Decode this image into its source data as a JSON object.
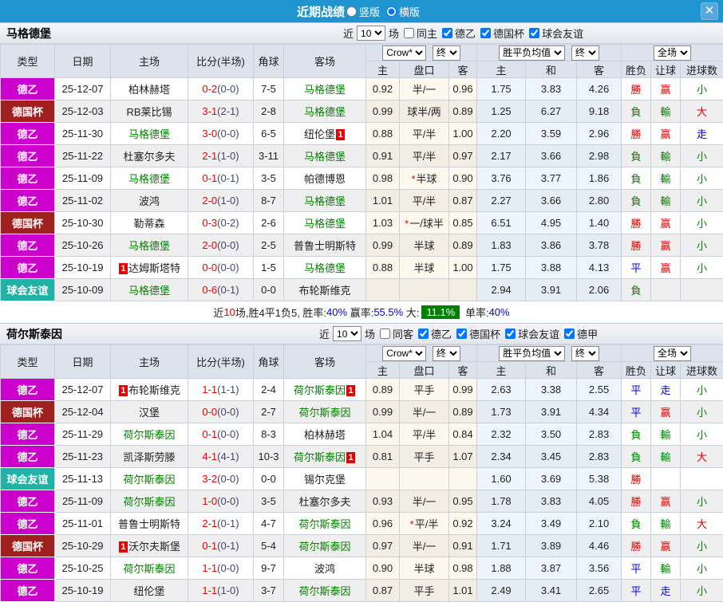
{
  "titlebar": {
    "title": "近期战绩",
    "radio_vertical": {
      "label": "竖版",
      "checked": false
    },
    "radio_horizontal": {
      "label": "横版",
      "checked": true
    },
    "close_glyph": "✕"
  },
  "cols": {
    "type": "类型",
    "date": "日期",
    "home": "主场",
    "score": "比分(半场)",
    "corner": "角球",
    "away": "客场",
    "sub": [
      "主",
      "盘口",
      "客",
      "主",
      "和",
      "客",
      "胜负",
      "让球",
      "进球数"
    ]
  },
  "colors": {
    "accent_blue": "#1f95d0",
    "league2_magenta": "#cc00cc",
    "cup_darkred": "#a02020",
    "friendly_teal": "#21b2a6",
    "win_red": "#e60000",
    "lose_green": "#008000",
    "draw_blue": "#0000ee",
    "highlight_green_bg": "#008000"
  },
  "sections": [
    {
      "team": "马格德堡",
      "filter": {
        "near": "近",
        "count": "10",
        "games": "场",
        "same": {
          "label": "同主",
          "checked": false
        },
        "leagues": [
          {
            "label": "德乙",
            "checked": true
          },
          {
            "label": "德国杯",
            "checked": true
          },
          {
            "label": "球会友谊",
            "checked": true
          }
        ]
      },
      "dd": {
        "odds": "Crow*",
        "fin1": "终",
        "avg": "胜平负均值",
        "fin2": "终",
        "scope": "全场"
      },
      "rows": [
        {
          "tc": "l2",
          "tp": "德乙",
          "d": "25-12-07",
          "h": {
            "n": "柏林赫塔",
            "g": 0
          },
          "s": [
            "0-2",
            "(0-0)"
          ],
          "c": "7-5",
          "a": {
            "n": "马格德堡",
            "g": 1
          },
          "o": [
            "0.92",
            "半/一",
            "0.96"
          ],
          "st": 0,
          "v": [
            "1.75",
            "3.83",
            "4.26"
          ],
          "r": [
            [
              "勝",
              "r"
            ],
            [
              "赢",
              "r"
            ],
            [
              "小",
              "g"
            ]
          ]
        },
        {
          "tc": "cup",
          "tp": "德国杯",
          "d": "25-12-03",
          "h": {
            "n": "RB莱比锡",
            "g": 0
          },
          "s": [
            "3-1",
            "(2-1)"
          ],
          "c": "2-8",
          "a": {
            "n": "马格德堡",
            "g": 1
          },
          "o": [
            "0.99",
            "球半/两",
            "0.89"
          ],
          "st": 0,
          "v": [
            "1.25",
            "6.27",
            "9.18"
          ],
          "r": [
            [
              "負",
              "g"
            ],
            [
              "輸",
              "g"
            ],
            [
              "大",
              "r"
            ]
          ]
        },
        {
          "tc": "l2",
          "tp": "德乙",
          "d": "25-11-30",
          "h": {
            "n": "马格德堡",
            "g": 1
          },
          "s": [
            "3-0",
            "(0-0)"
          ],
          "c": "6-5",
          "a": {
            "n": "纽伦堡",
            "g": 0,
            "b": "1",
            "bp": "a"
          },
          "o": [
            "0.88",
            "平/半",
            "1.00"
          ],
          "st": 0,
          "v": [
            "2.20",
            "3.59",
            "2.96"
          ],
          "r": [
            [
              "勝",
              "r"
            ],
            [
              "赢",
              "r"
            ],
            [
              "走",
              "b"
            ]
          ]
        },
        {
          "tc": "l2",
          "tp": "德乙",
          "d": "25-11-22",
          "h": {
            "n": "杜塞尔多夫",
            "g": 0
          },
          "s": [
            "2-1",
            "(1-0)"
          ],
          "c": "3-11",
          "a": {
            "n": "马格德堡",
            "g": 1
          },
          "o": [
            "0.91",
            "平/半",
            "0.97"
          ],
          "st": 0,
          "v": [
            "2.17",
            "3.66",
            "2.98"
          ],
          "r": [
            [
              "負",
              "g"
            ],
            [
              "輸",
              "g"
            ],
            [
              "小",
              "g"
            ]
          ]
        },
        {
          "tc": "l2",
          "tp": "德乙",
          "d": "25-11-09",
          "h": {
            "n": "马格德堡",
            "g": 1
          },
          "s": [
            "0-1",
            "(0-1)"
          ],
          "c": "3-5",
          "a": {
            "n": "帕德博恩",
            "g": 0
          },
          "o": [
            "0.98",
            "半球",
            "0.90"
          ],
          "st": 1,
          "v": [
            "3.76",
            "3.77",
            "1.86"
          ],
          "r": [
            [
              "負",
              "g"
            ],
            [
              "輸",
              "g"
            ],
            [
              "小",
              "g"
            ]
          ]
        },
        {
          "tc": "l2",
          "tp": "德乙",
          "d": "25-11-02",
          "h": {
            "n": "波鸿",
            "g": 0
          },
          "s": [
            "2-0",
            "(1-0)"
          ],
          "c": "8-7",
          "a": {
            "n": "马格德堡",
            "g": 1
          },
          "o": [
            "1.01",
            "平/半",
            "0.87"
          ],
          "st": 0,
          "v": [
            "2.27",
            "3.66",
            "2.80"
          ],
          "r": [
            [
              "負",
              "g"
            ],
            [
              "輸",
              "g"
            ],
            [
              "小",
              "g"
            ]
          ]
        },
        {
          "tc": "cup",
          "tp": "德国杯",
          "d": "25-10-30",
          "h": {
            "n": "勒蒂森",
            "g": 0
          },
          "s": [
            "0-3",
            "(0-2)"
          ],
          "c": "2-6",
          "a": {
            "n": "马格德堡",
            "g": 1
          },
          "o": [
            "1.03",
            "一/球半",
            "0.85"
          ],
          "st": 1,
          "v": [
            "6.51",
            "4.95",
            "1.40"
          ],
          "r": [
            [
              "勝",
              "r"
            ],
            [
              "赢",
              "r"
            ],
            [
              "小",
              "g"
            ]
          ]
        },
        {
          "tc": "l2",
          "tp": "德乙",
          "d": "25-10-26",
          "h": {
            "n": "马格德堡",
            "g": 1
          },
          "s": [
            "2-0",
            "(0-0)"
          ],
          "c": "2-5",
          "a": {
            "n": "普鲁士明斯特",
            "g": 0
          },
          "o": [
            "0.99",
            "半球",
            "0.89"
          ],
          "st": 0,
          "v": [
            "1.83",
            "3.86",
            "3.78"
          ],
          "r": [
            [
              "勝",
              "r"
            ],
            [
              "赢",
              "r"
            ],
            [
              "小",
              "g"
            ]
          ]
        },
        {
          "tc": "l2",
          "tp": "德乙",
          "d": "25-10-19",
          "h": {
            "n": "达姆斯塔特",
            "g": 0,
            "b": "1",
            "bp": "b"
          },
          "s": [
            "0-0",
            "(0-0)"
          ],
          "c": "1-5",
          "a": {
            "n": "马格德堡",
            "g": 1
          },
          "o": [
            "0.88",
            "半球",
            "1.00"
          ],
          "st": 0,
          "v": [
            "1.75",
            "3.88",
            "4.13"
          ],
          "r": [
            [
              "平",
              "b"
            ],
            [
              "赢",
              "r"
            ],
            [
              "小",
              "g"
            ]
          ]
        },
        {
          "tc": "fr",
          "tp": "球会友谊",
          "d": "25-10-09",
          "h": {
            "n": "马格德堡",
            "g": 1
          },
          "s": [
            "0-6",
            "(0-1)"
          ],
          "c": "0-0",
          "a": {
            "n": "布轮斯维克",
            "g": 0
          },
          "o": [
            "",
            "",
            ""
          ],
          "st": 0,
          "v": [
            "2.94",
            "3.91",
            "2.06"
          ],
          "r": [
            [
              "負",
              "g"
            ],
            null,
            null
          ]
        }
      ],
      "summary": {
        "parts": [
          [
            "近",
            "k"
          ],
          [
            "10",
            "r"
          ],
          [
            "场,胜4平1负5, ",
            "k"
          ],
          [
            "胜率:",
            "k"
          ],
          [
            "40%",
            "b"
          ],
          [
            " 赢率:",
            "k"
          ],
          [
            "55.5%",
            "b"
          ],
          [
            " 大:",
            "k"
          ],
          [
            "11.1%",
            "hl"
          ],
          [
            " 单率:",
            "k"
          ],
          [
            "40%",
            "b"
          ]
        ]
      }
    },
    {
      "team": "荷尔斯泰因",
      "filter": {
        "near": "近",
        "count": "10",
        "games": "场",
        "same": {
          "label": "同客",
          "checked": false
        },
        "leagues": [
          {
            "label": "德乙",
            "checked": true
          },
          {
            "label": "德国杯",
            "checked": true
          },
          {
            "label": "球会友谊",
            "checked": true
          },
          {
            "label": "德甲",
            "checked": true
          }
        ]
      },
      "dd": {
        "odds": "Crow*",
        "fin1": "终",
        "avg": "胜平负均值",
        "fin2": "终",
        "scope": "全场"
      },
      "rows": [
        {
          "tc": "l2",
          "tp": "德乙",
          "d": "25-12-07",
          "h": {
            "n": "布轮斯维克",
            "g": 0,
            "b": "1",
            "bp": "b"
          },
          "s": [
            "1-1",
            "(1-1)"
          ],
          "c": "2-4",
          "a": {
            "n": "荷尔斯泰因",
            "g": 1,
            "b": "1",
            "bp": "a"
          },
          "o": [
            "0.89",
            "平手",
            "0.99"
          ],
          "st": 0,
          "v": [
            "2.63",
            "3.38",
            "2.55"
          ],
          "r": [
            [
              "平",
              "b"
            ],
            [
              "走",
              "b"
            ],
            [
              "小",
              "g"
            ]
          ]
        },
        {
          "tc": "cup",
          "tp": "德国杯",
          "d": "25-12-04",
          "h": {
            "n": "汉堡",
            "g": 0
          },
          "s": [
            "0-0",
            "(0-0)"
          ],
          "c": "2-7",
          "a": {
            "n": "荷尔斯泰因",
            "g": 1
          },
          "o": [
            "0.99",
            "半/一",
            "0.89"
          ],
          "st": 0,
          "v": [
            "1.73",
            "3.91",
            "4.34"
          ],
          "r": [
            [
              "平",
              "b"
            ],
            [
              "赢",
              "r"
            ],
            [
              "小",
              "g"
            ]
          ]
        },
        {
          "tc": "l2",
          "tp": "德乙",
          "d": "25-11-29",
          "h": {
            "n": "荷尔斯泰因",
            "g": 1
          },
          "s": [
            "0-1",
            "(0-0)"
          ],
          "c": "8-3",
          "a": {
            "n": "柏林赫塔",
            "g": 0
          },
          "o": [
            "1.04",
            "平/半",
            "0.84"
          ],
          "st": 0,
          "v": [
            "2.32",
            "3.50",
            "2.83"
          ],
          "r": [
            [
              "負",
              "g"
            ],
            [
              "輸",
              "g"
            ],
            [
              "小",
              "g"
            ]
          ]
        },
        {
          "tc": "l2",
          "tp": "德乙",
          "d": "25-11-23",
          "h": {
            "n": "凯泽斯劳滕",
            "g": 0
          },
          "s": [
            "4-1",
            "(4-1)"
          ],
          "c": "10-3",
          "a": {
            "n": "荷尔斯泰因",
            "g": 1,
            "b": "1",
            "bp": "a"
          },
          "o": [
            "0.81",
            "平手",
            "1.07"
          ],
          "st": 0,
          "v": [
            "2.34",
            "3.45",
            "2.83"
          ],
          "r": [
            [
              "負",
              "g"
            ],
            [
              "輸",
              "g"
            ],
            [
              "大",
              "r"
            ]
          ]
        },
        {
          "tc": "fr",
          "tp": "球会友谊",
          "d": "25-11-13",
          "h": {
            "n": "荷尔斯泰因",
            "g": 1
          },
          "s": [
            "3-2",
            "(0-0)"
          ],
          "c": "0-0",
          "a": {
            "n": "锡尔克堡",
            "g": 0
          },
          "o": [
            "",
            "",
            ""
          ],
          "st": 0,
          "v": [
            "1.60",
            "3.69",
            "5.38"
          ],
          "r": [
            [
              "勝",
              "r"
            ],
            null,
            null
          ]
        },
        {
          "tc": "l2",
          "tp": "德乙",
          "d": "25-11-09",
          "h": {
            "n": "荷尔斯泰因",
            "g": 1
          },
          "s": [
            "1-0",
            "(0-0)"
          ],
          "c": "3-5",
          "a": {
            "n": "杜塞尔多夫",
            "g": 0
          },
          "o": [
            "0.93",
            "半/一",
            "0.95"
          ],
          "st": 0,
          "v": [
            "1.78",
            "3.83",
            "4.05"
          ],
          "r": [
            [
              "勝",
              "r"
            ],
            [
              "赢",
              "r"
            ],
            [
              "小",
              "g"
            ]
          ]
        },
        {
          "tc": "l2",
          "tp": "德乙",
          "d": "25-11-01",
          "h": {
            "n": "普鲁士明斯特",
            "g": 0
          },
          "s": [
            "2-1",
            "(0-1)"
          ],
          "c": "4-7",
          "a": {
            "n": "荷尔斯泰因",
            "g": 1
          },
          "o": [
            "0.96",
            "平/半",
            "0.92"
          ],
          "st": 1,
          "v": [
            "3.24",
            "3.49",
            "2.10"
          ],
          "r": [
            [
              "負",
              "g"
            ],
            [
              "輸",
              "g"
            ],
            [
              "大",
              "r"
            ]
          ]
        },
        {
          "tc": "cup",
          "tp": "德国杯",
          "d": "25-10-29",
          "h": {
            "n": "沃尔夫斯堡",
            "g": 0,
            "b": "1",
            "bp": "b"
          },
          "s": [
            "0-1",
            "(0-1)"
          ],
          "c": "5-4",
          "a": {
            "n": "荷尔斯泰因",
            "g": 1
          },
          "o": [
            "0.97",
            "半/一",
            "0.91"
          ],
          "st": 0,
          "v": [
            "1.71",
            "3.89",
            "4.46"
          ],
          "r": [
            [
              "勝",
              "r"
            ],
            [
              "赢",
              "r"
            ],
            [
              "小",
              "g"
            ]
          ]
        },
        {
          "tc": "l2",
          "tp": "德乙",
          "d": "25-10-25",
          "h": {
            "n": "荷尔斯泰因",
            "g": 1
          },
          "s": [
            "1-1",
            "(0-0)"
          ],
          "c": "9-7",
          "a": {
            "n": "波鸿",
            "g": 0
          },
          "o": [
            "0.90",
            "半球",
            "0.98"
          ],
          "st": 0,
          "v": [
            "1.88",
            "3.87",
            "3.56"
          ],
          "r": [
            [
              "平",
              "b"
            ],
            [
              "輸",
              "g"
            ],
            [
              "小",
              "g"
            ]
          ]
        },
        {
          "tc": "l2",
          "tp": "德乙",
          "d": "25-10-19",
          "h": {
            "n": "纽伦堡",
            "g": 0
          },
          "s": [
            "1-1",
            "(1-0)"
          ],
          "c": "3-7",
          "a": {
            "n": "荷尔斯泰因",
            "g": 1
          },
          "o": [
            "0.87",
            "平手",
            "1.01"
          ],
          "st": 0,
          "v": [
            "2.49",
            "3.41",
            "2.65"
          ],
          "r": [
            [
              "平",
              "b"
            ],
            [
              "走",
              "b"
            ],
            [
              "小",
              "g"
            ]
          ]
        }
      ],
      "summary": null
    }
  ]
}
